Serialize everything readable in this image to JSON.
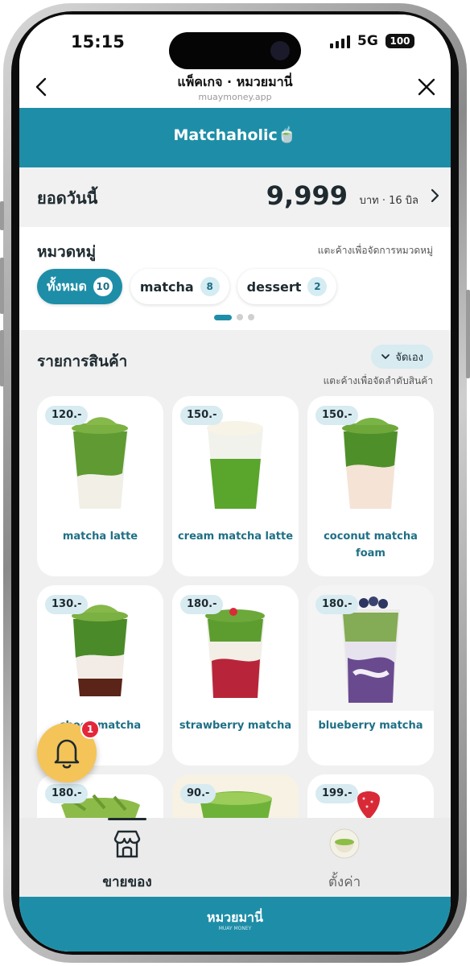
{
  "status_bar": {
    "time": "15:15",
    "network": "5G",
    "battery": "100"
  },
  "browser": {
    "title": "แพ็คเกจ · หมวยมานี่",
    "url": "muaymoney.app"
  },
  "shop": {
    "name": "Matchaholic🍵"
  },
  "sales": {
    "label": "ยอดวันนี้",
    "amount": "9,999",
    "unit": "บาท · 16 บิล"
  },
  "categories": {
    "title": "หมวดหมู่",
    "hint": "แตะค้างเพื่อจัดการหมวดหมู่",
    "items": [
      {
        "label": "ทั้งหมด",
        "count": "10",
        "active": true
      },
      {
        "label": "matcha",
        "count": "8",
        "active": false
      },
      {
        "label": "dessert",
        "count": "2",
        "active": false
      }
    ]
  },
  "products": {
    "title": "รายการสินค้า",
    "sort_label": "จัดเอง",
    "hint": "แตะค้างเพื่อจัดลำดับสินค้า",
    "items": [
      {
        "price": "120.-",
        "name": "matcha latte"
      },
      {
        "price": "150.-",
        "name": "cream matcha latte"
      },
      {
        "price": "150.-",
        "name": "coconut matcha foam"
      },
      {
        "price": "130.-",
        "name": "choco matcha"
      },
      {
        "price": "180.-",
        "name": "strawberry matcha"
      },
      {
        "price": "180.-",
        "name": "blueberry matcha"
      },
      {
        "price": "180.-",
        "name": ""
      },
      {
        "price": "90.-",
        "name": ""
      },
      {
        "price": "199.-",
        "name": ""
      }
    ]
  },
  "notification": {
    "count": "1"
  },
  "tabbar": {
    "sell_label": "ขายของ",
    "settings_label": "ตั้งค่า"
  },
  "footer": {
    "brand": "หมวยมานี่",
    "sub": "MUAY MONEY"
  },
  "colors": {
    "accent": "#1e8ea8",
    "dark": "#1e2a30",
    "fab": "#f4c458",
    "badge": "#e5263a"
  }
}
